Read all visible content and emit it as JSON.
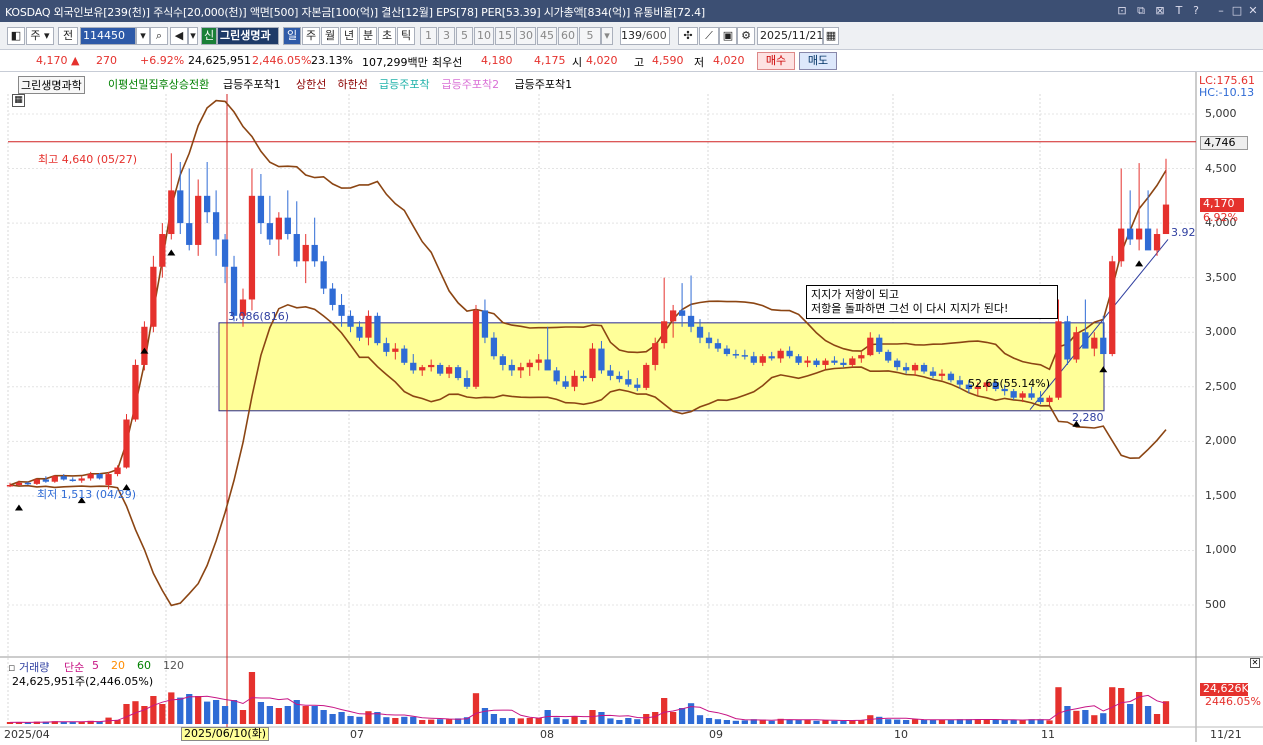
{
  "titlebar": {
    "text": "KOSDAQ 외국인보유[239(천)] 주식수[20,000(천)] 액면[500] 자본금[100(억)] 결산[12월] EPS[78] PER[53.39] 시가총액[834(억)] 유통비율[72.4]"
  },
  "toolbar": {
    "period_label": "주",
    "all_label": "전",
    "code": "114450",
    "new_badge": "신",
    "stock_name": "그린생명과",
    "intervals": [
      "일",
      "주",
      "월",
      "년",
      "분",
      "초",
      "틱"
    ],
    "minutes": [
      "1",
      "3",
      "5",
      "10",
      "15",
      "30",
      "45",
      "60"
    ],
    "custom_min": "5",
    "count": "139",
    "count_total": "/600",
    "date": "2025/11/21"
  },
  "quote": {
    "price": "4,170",
    "change": "270",
    "change_pct": "+6.92%",
    "volume": "24,625,951",
    "volume_pct": "2,446.05%",
    "turnover": "23.13%",
    "amount": "107,299백만",
    "best_label": "최우선",
    "ask": "4,180",
    "bid": "4,175",
    "open_label": "시",
    "open": "4,020",
    "high_label": "고",
    "high": "4,590",
    "low_label": "저",
    "low": "4,020",
    "buy": "매수",
    "sell": "매도"
  },
  "legend": {
    "name": "그린생명과학",
    "items": [
      {
        "label": "이평선밀집후상승전환",
        "color": "#008000"
      },
      {
        "label": "급등주포착1",
        "color": "#000000"
      },
      {
        "label": "상한선",
        "color": "#8B0000"
      },
      {
        "label": "하한선",
        "color": "#8B0000"
      },
      {
        "label": "급등주포착",
        "color": "#20b2aa"
      },
      {
        "label": "급등주포착2",
        "color": "#da70d6"
      },
      {
        "label": "급등주포착1",
        "color": "#000000"
      }
    ],
    "lc": "LC:175.61",
    "hc": "HC:-10.13"
  },
  "annotations": {
    "high": "최고 4,640 (05/27)",
    "low": "최저 1,513 (04/29)",
    "level": "3,086(816)",
    "pct": "52.65(55.14%)",
    "box_low": "2,280",
    "trend": "3.92",
    "note1": "지지가 저항이 되고",
    "note2": "저항을 돌파하면 그선 이 다시 지지가 된다!"
  },
  "price_axis": {
    "labels": [
      "5,000",
      "4,500",
      "4,000",
      "3,500",
      "3,000",
      "2,500",
      "2,000",
      "1,500",
      "1,000",
      "500"
    ],
    "ref_label": "4,746",
    "cur_label": "4,170",
    "cur_pct": "6.92%"
  },
  "volume_panel": {
    "title": "거래량",
    "ma_label": "단순",
    "ma": [
      {
        "label": "5",
        "color": "#c71585"
      },
      {
        "label": "20",
        "color": "#ff8c00"
      },
      {
        "label": "60",
        "color": "#008000"
      },
      {
        "label": "120",
        "color": "#555555"
      }
    ],
    "value": "24,625,951주(2,446.05%)",
    "axis_value": "24,626K",
    "axis_pct": "2446.05%"
  },
  "date_axis": {
    "labels": [
      "2025/04",
      "07",
      "08",
      "09",
      "10",
      "11",
      "11/21"
    ],
    "cursor": "2025/06/10(화)"
  },
  "colors": {
    "up": "#e5312d",
    "down": "#2f6bd5",
    "band": "#8b4513",
    "box": "#ffff99"
  },
  "chart_data": {
    "type": "candlestick",
    "ylim": [
      0,
      5200
    ],
    "ohlc": [
      [
        1600,
        1620,
        1580,
        1600
      ],
      [
        1600,
        1640,
        1590,
        1620
      ],
      [
        1620,
        1630,
        1600,
        1610
      ],
      [
        1610,
        1660,
        1600,
        1650
      ],
      [
        1650,
        1680,
        1620,
        1630
      ],
      [
        1630,
        1690,
        1620,
        1680
      ],
      [
        1680,
        1700,
        1640,
        1650
      ],
      [
        1650,
        1670,
        1630,
        1640
      ],
      [
        1640,
        1680,
        1620,
        1660
      ],
      [
        1660,
        1720,
        1640,
        1700
      ],
      [
        1700,
        1710,
        1650,
        1660
      ],
      [
        1600,
        1720,
        1560,
        1700
      ],
      [
        1700,
        1780,
        1680,
        1760
      ],
      [
        1760,
        2250,
        1750,
        2200
      ],
      [
        2200,
        2750,
        2180,
        2700
      ],
      [
        2700,
        3100,
        2650,
        3050
      ],
      [
        3050,
        3700,
        3000,
        3600
      ],
      [
        3600,
        4000,
        3500,
        3900
      ],
      [
        3900,
        4640,
        3850,
        4300
      ],
      [
        4300,
        4560,
        3900,
        4000
      ],
      [
        4000,
        4500,
        3750,
        3800
      ],
      [
        3800,
        4400,
        3700,
        4250
      ],
      [
        4250,
        4560,
        4000,
        4100
      ],
      [
        4100,
        4300,
        3700,
        3850
      ],
      [
        3850,
        3900,
        3450,
        3600
      ],
      [
        3600,
        3700,
        3100,
        3150
      ],
      [
        3150,
        3400,
        3050,
        3300
      ],
      [
        3300,
        4500,
        3200,
        4250
      ],
      [
        4250,
        4450,
        3900,
        4000
      ],
      [
        4000,
        4250,
        3800,
        3850
      ],
      [
        3850,
        4100,
        3700,
        4050
      ],
      [
        4050,
        4300,
        3850,
        3900
      ],
      [
        3900,
        4200,
        3600,
        3650
      ],
      [
        3650,
        3900,
        3450,
        3800
      ],
      [
        3800,
        4050,
        3600,
        3650
      ],
      [
        3650,
        3700,
        3350,
        3400
      ],
      [
        3400,
        3450,
        3200,
        3250
      ],
      [
        3250,
        3350,
        3050,
        3150
      ],
      [
        3150,
        3200,
        3000,
        3050
      ],
      [
        3050,
        3100,
        2920,
        2950
      ],
      [
        2950,
        3200,
        2880,
        3150
      ],
      [
        3150,
        3180,
        2880,
        2900
      ],
      [
        2900,
        2950,
        2780,
        2820
      ],
      [
        2820,
        2900,
        2750,
        2850
      ],
      [
        2850,
        2880,
        2700,
        2720
      ],
      [
        2720,
        2800,
        2620,
        2650
      ],
      [
        2650,
        2700,
        2600,
        2680
      ],
      [
        2680,
        2750,
        2640,
        2700
      ],
      [
        2700,
        2720,
        2600,
        2620
      ],
      [
        2620,
        2700,
        2580,
        2680
      ],
      [
        2680,
        2700,
        2560,
        2580
      ],
      [
        2580,
        2650,
        2480,
        2500
      ],
      [
        2500,
        3250,
        2480,
        3200
      ],
      [
        3200,
        3300,
        2900,
        2950
      ],
      [
        2950,
        3000,
        2750,
        2780
      ],
      [
        2780,
        2800,
        2650,
        2700
      ],
      [
        2700,
        2750,
        2600,
        2650
      ],
      [
        2650,
        2720,
        2580,
        2680
      ],
      [
        2680,
        2750,
        2600,
        2720
      ],
      [
        2720,
        2800,
        2650,
        2750
      ],
      [
        2750,
        3050,
        2700,
        2650
      ],
      [
        2650,
        2680,
        2520,
        2550
      ],
      [
        2550,
        2600,
        2480,
        2500
      ],
      [
        2500,
        2650,
        2460,
        2600
      ],
      [
        2600,
        2650,
        2550,
        2580
      ],
      [
        2580,
        2900,
        2550,
        2850
      ],
      [
        2850,
        2920,
        2620,
        2650
      ],
      [
        2650,
        2700,
        2560,
        2600
      ],
      [
        2600,
        2640,
        2540,
        2570
      ],
      [
        2570,
        2650,
        2500,
        2520
      ],
      [
        2520,
        2580,
        2460,
        2490
      ],
      [
        2490,
        2720,
        2470,
        2700
      ],
      [
        2700,
        2950,
        2650,
        2900
      ],
      [
        2900,
        3500,
        2850,
        3100
      ],
      [
        3100,
        3250,
        2950,
        3200
      ],
      [
        3200,
        3450,
        3050,
        3150
      ],
      [
        3150,
        3520,
        3000,
        3050
      ],
      [
        3050,
        3120,
        2900,
        2950
      ],
      [
        2950,
        3000,
        2850,
        2900
      ],
      [
        2900,
        2940,
        2820,
        2850
      ],
      [
        2850,
        2880,
        2780,
        2800
      ],
      [
        2800,
        2840,
        2760,
        2790
      ],
      [
        2790,
        2840,
        2750,
        2780
      ],
      [
        2780,
        2820,
        2700,
        2720
      ],
      [
        2720,
        2800,
        2690,
        2780
      ],
      [
        2780,
        2820,
        2740,
        2760
      ],
      [
        2760,
        2850,
        2720,
        2830
      ],
      [
        2830,
        2870,
        2760,
        2780
      ],
      [
        2780,
        2800,
        2700,
        2720
      ],
      [
        2720,
        2780,
        2680,
        2740
      ],
      [
        2740,
        2760,
        2680,
        2700
      ],
      [
        2700,
        2760,
        2660,
        2740
      ],
      [
        2740,
        2780,
        2700,
        2720
      ],
      [
        2720,
        2760,
        2680,
        2700
      ],
      [
        2700,
        2780,
        2680,
        2760
      ],
      [
        2760,
        2820,
        2720,
        2790
      ],
      [
        2790,
        3000,
        2780,
        2950
      ],
      [
        2950,
        2980,
        2800,
        2820
      ],
      [
        2820,
        2840,
        2720,
        2740
      ],
      [
        2740,
        2760,
        2650,
        2680
      ],
      [
        2680,
        2720,
        2620,
        2650
      ],
      [
        2650,
        2720,
        2600,
        2700
      ],
      [
        2700,
        2720,
        2620,
        2640
      ],
      [
        2640,
        2680,
        2580,
        2600
      ],
      [
        2600,
        2660,
        2560,
        2620
      ],
      [
        2620,
        2640,
        2540,
        2560
      ],
      [
        2560,
        2600,
        2480,
        2520
      ],
      [
        2520,
        2560,
        2440,
        2480
      ],
      [
        2480,
        2540,
        2420,
        2500
      ],
      [
        2500,
        2560,
        2460,
        2540
      ],
      [
        2540,
        2560,
        2460,
        2480
      ],
      [
        2480,
        2520,
        2420,
        2460
      ],
      [
        2460,
        2480,
        2380,
        2400
      ],
      [
        2400,
        2460,
        2360,
        2440
      ],
      [
        2440,
        2500,
        2380,
        2400
      ],
      [
        2400,
        2460,
        2340,
        2360
      ],
      [
        2360,
        2420,
        2330,
        2400
      ],
      [
        2400,
        3300,
        2380,
        3100
      ],
      [
        3100,
        3150,
        2700,
        2750
      ],
      [
        2750,
        3050,
        2720,
        3000
      ],
      [
        3000,
        3300,
        2950,
        2850
      ],
      [
        2850,
        3000,
        2780,
        2950
      ],
      [
        2950,
        3150,
        2880,
        2800
      ],
      [
        2800,
        3700,
        2780,
        3650
      ],
      [
        3650,
        4500,
        3600,
        3950
      ],
      [
        3950,
        4300,
        3800,
        3850
      ],
      [
        3850,
        4550,
        3750,
        3950
      ],
      [
        3950,
        4300,
        3850,
        3750
      ],
      [
        3750,
        3950,
        3700,
        3900
      ],
      [
        3900,
        4590,
        4020,
        4170
      ]
    ]
  }
}
